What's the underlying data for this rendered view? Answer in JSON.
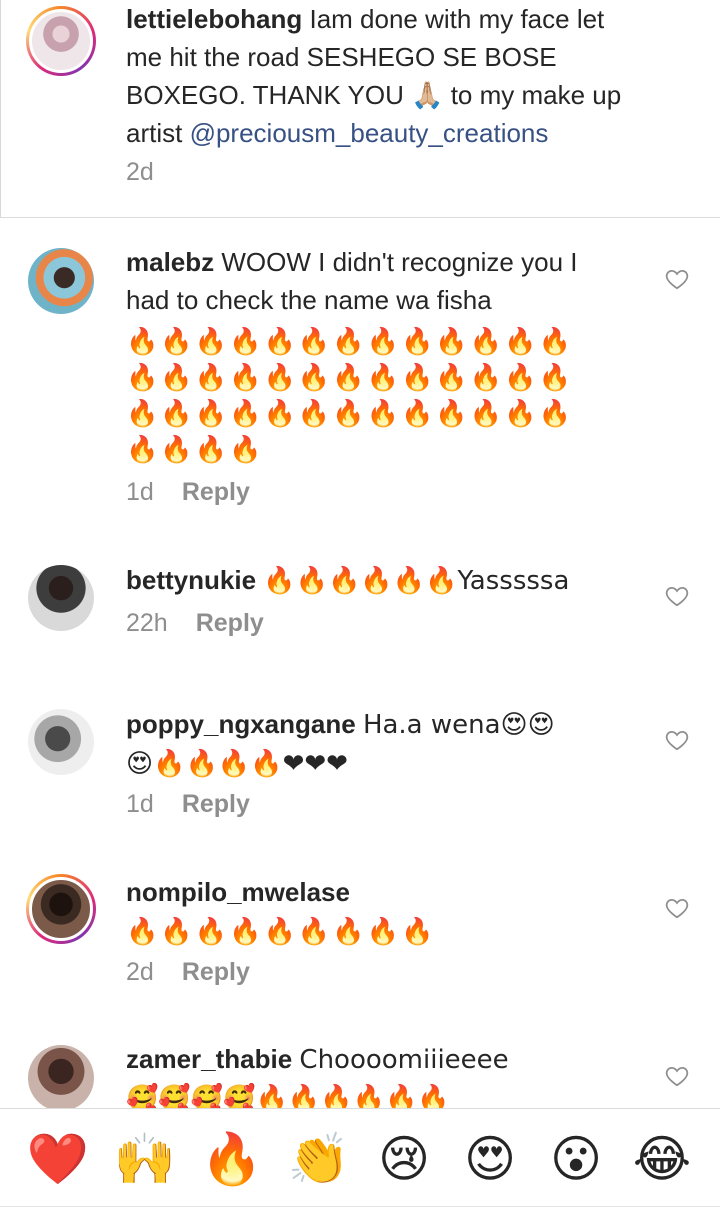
{
  "comments": [
    {
      "username": "lettielebohang",
      "body": "Iam done with my face let me hit the road SESHEGO SE BOSE BOXEGO.  THANK YOU 🙏🏼 to my make up artist ",
      "mention": "@preciousm_beauty_creations",
      "time": "2d",
      "reply": ""
    },
    {
      "username": "malebz",
      "body": "WOOW I didn't recognize you I had to check the name wa fisha",
      "emojis": "🔥🔥🔥🔥🔥🔥🔥🔥🔥🔥🔥🔥🔥🔥🔥🔥🔥🔥🔥🔥🔥🔥🔥🔥🔥🔥🔥🔥🔥🔥🔥🔥🔥🔥🔥🔥🔥🔥🔥🔥🔥🔥🔥",
      "time": "1d",
      "reply": "Reply"
    },
    {
      "username": "bettynukie",
      "body": "🔥🔥🔥🔥🔥🔥Yasssssa",
      "time": "22h",
      "reply": "Reply"
    },
    {
      "username": "poppy_ngxangane",
      "body": "Ha.a wena😍😍😍🔥🔥🔥🔥❤❤❤",
      "time": "1d",
      "reply": "Reply"
    },
    {
      "username": "nompilo_mwelase",
      "body": "🔥🔥🔥🔥🔥🔥🔥🔥🔥",
      "time": "2d",
      "reply": "Reply"
    },
    {
      "username": "zamer_thabie",
      "body": "Choooomiiieeee 🥰🥰🥰🥰🔥🔥🔥🔥🔥🔥",
      "time": "",
      "reply": ""
    }
  ],
  "reactions": [
    "❤️",
    "🙌",
    "🔥",
    "👏",
    "😢",
    "😍",
    "😮",
    "😂"
  ],
  "colors": {
    "text": "#262626",
    "meta": "#8e8e8e",
    "mention": "#385185"
  },
  "icons": {
    "like": "heart-outline-icon"
  }
}
